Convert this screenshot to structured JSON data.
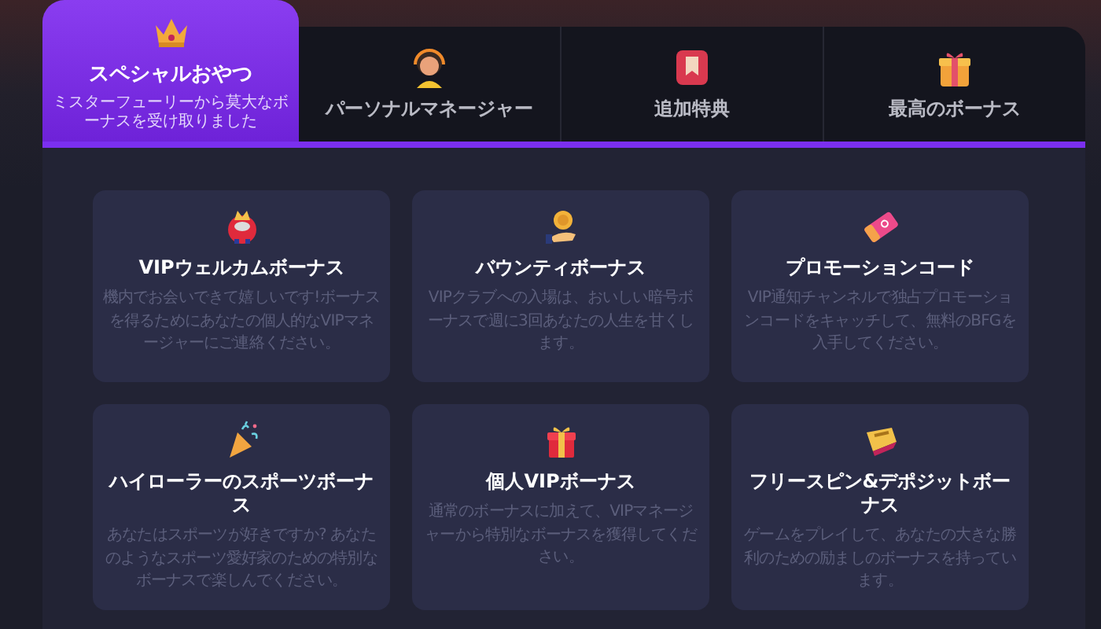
{
  "tabs": [
    {
      "label": "スペシャルおやつ",
      "subtitle": "ミスターフューリーから莫大なボーナスを受け取りました",
      "selected": true
    },
    {
      "label": "パーソナルマネージャー",
      "selected": false
    },
    {
      "label": "追加特典",
      "selected": false
    },
    {
      "label": "最高のボーナス",
      "selected": false
    }
  ],
  "cards": [
    {
      "title": "VIPウェルカムボーナス",
      "description": "機内でお会いできて嬉しいです!ボーナスを得るためにあなたの個人的なVIPマネージャーにご連絡ください。"
    },
    {
      "title": "バウンティボーナス",
      "description": "VIPクラブへの入場は、おいしい暗号ボーナスで週に3回あなたの人生を甘くします。"
    },
    {
      "title": "プロモーションコード",
      "description": "VIP通知チャンネルで独占プロモーションコードをキャッチして、無料のBFGを入手してください。"
    },
    {
      "title": "ハイローラーのスポーツボーナス",
      "description": "あなたはスポーツが好きですか? あなたのようなスポーツ愛好家のための特別なボーナスで楽しんでください。"
    },
    {
      "title": "個人VIPボーナス",
      "description": "通常のボーナスに加えて、VIPマネージャーから特別なボーナスを獲得してください。"
    },
    {
      "title": "フリースピン&デポジットボーナス",
      "description": "ゲームをプレイして、あなたの大きな勝利のための励ましのボーナスを持っています。"
    }
  ]
}
